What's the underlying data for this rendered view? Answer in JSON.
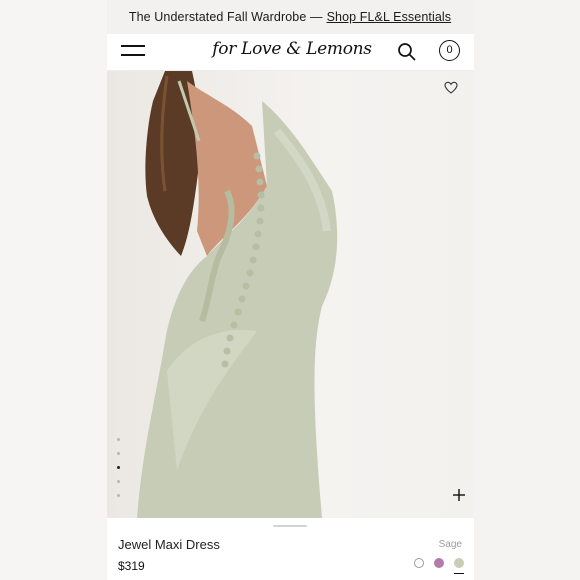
{
  "promo": {
    "text": "The Understated Fall Wardrobe —",
    "link": "Shop FL&L Essentials"
  },
  "header": {
    "logo": "for Love & Lemons",
    "bag_count": "0"
  },
  "icons": {
    "menu": "hamburger-menu-icon",
    "search": "search-icon",
    "bag": "bag-icon",
    "wishlist": "heart-icon",
    "zoom": "plus-icon"
  },
  "gallery": {
    "image_count": 5,
    "active_index": 2
  },
  "product": {
    "name": "Jewel Maxi Dress",
    "price": "$319",
    "color_label": "Sage",
    "swatches": [
      {
        "color": "#ffffff",
        "selected": false
      },
      {
        "color": "#b57aa9",
        "selected": false
      },
      {
        "color": "#c6cfb5",
        "selected": true
      }
    ]
  },
  "colors": {
    "dress": "#c7ccb6",
    "hair": "#5a3a24",
    "skin": "#c89379"
  }
}
